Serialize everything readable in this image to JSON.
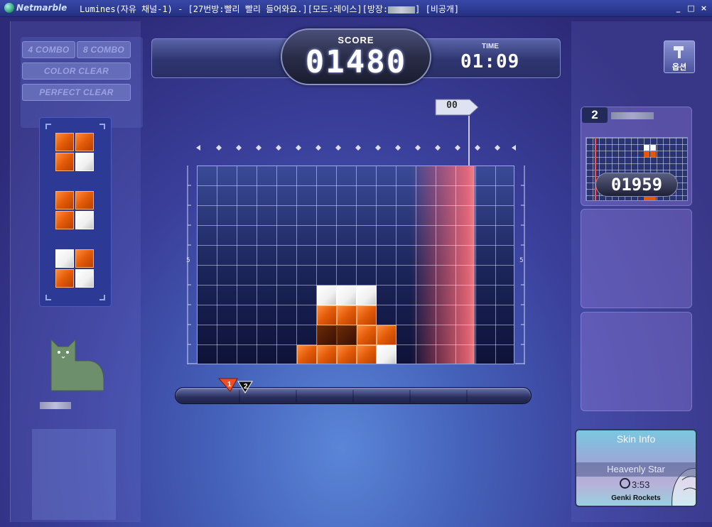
{
  "window": {
    "app_name": "Netmarble",
    "title": "Lumines(자유 채널-1) - [27번방:빨리 빨리 들어와요.][모드:레이스][방장:",
    "title_suffix": "] [비공개]",
    "minimize": "_",
    "maximize": "□",
    "close": "×"
  },
  "bonus": {
    "combo4": "4 COMBO",
    "combo8": "8 COMBO",
    "color_clear": "COLOR CLEAR",
    "perfect_clear": "PERFECT CLEAR"
  },
  "score": {
    "label": "SCORE",
    "value": "01480"
  },
  "time": {
    "label": "TIME",
    "value": "01:09"
  },
  "timeline_marker": "00",
  "board": {
    "side_label_left": "5",
    "side_label_right": "5"
  },
  "progress": {
    "player_badge": "1",
    "opponent_badge": "2"
  },
  "options_button": "옵션",
  "opponent": {
    "rank": "2",
    "score": "01959"
  },
  "skin_info": {
    "title": "Skin Info",
    "skin_name": "Heavenly Star",
    "duration": "3:53",
    "artist": "Genki Rockets"
  },
  "colors": {
    "orange": "#e25a08",
    "white": "#ffffff",
    "sweep": "#ff6a70"
  }
}
